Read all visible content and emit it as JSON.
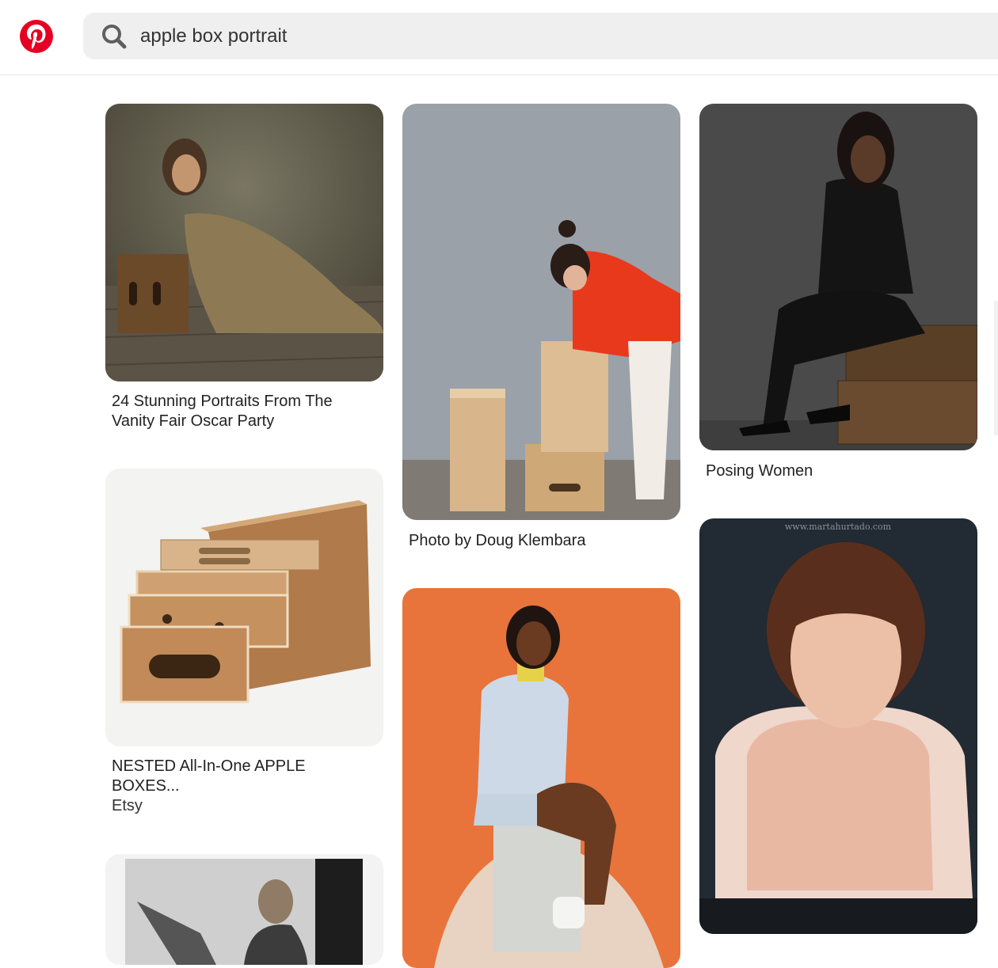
{
  "search": {
    "query": "apple box portrait"
  },
  "pins": [
    {
      "title": "24 Stunning Portraits From The Vanity Fair Oscar Party",
      "source": ""
    },
    {
      "title": "NESTED All-In-One APPLE BOXES...",
      "source": "Etsy"
    },
    {
      "title": "",
      "source": ""
    },
    {
      "title": "Photo by Doug Klembara",
      "source": ""
    },
    {
      "title": "",
      "source": ""
    },
    {
      "title": "Posing Women",
      "source": ""
    },
    {
      "title": "",
      "source": "",
      "watermark": "www.martahurtado.com"
    }
  ],
  "colors": {
    "brand": "#e60023",
    "search_bg": "#efefef",
    "orange_backdrop": "#e8743b"
  },
  "icons": {
    "logo": "pinterest-logo-icon",
    "search": "search-icon"
  }
}
